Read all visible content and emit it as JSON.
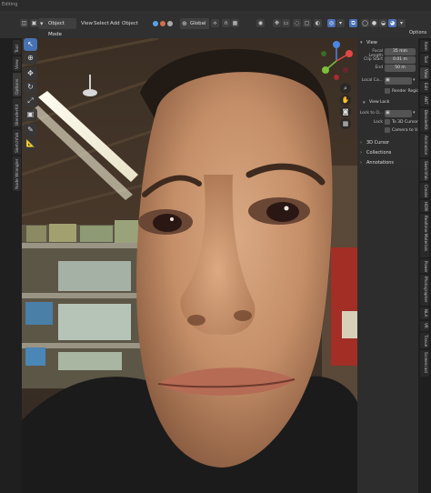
{
  "window": {
    "top_edge_text": "Editing"
  },
  "header": {
    "mode": "Object Mode",
    "menus": [
      "View",
      "Select",
      "Add",
      "Object"
    ],
    "transform_orientation": "Global",
    "options_label": "Options"
  },
  "left_tabs": [
    "Tool",
    "View",
    "Options",
    "BlenderKit",
    "Sketchfab",
    "Node Wrangler"
  ],
  "n_panel": {
    "view_section": "View",
    "focal_length_label": "Focal Length",
    "focal_length_value": "35 mm",
    "clip_start_label": "Clip Start",
    "clip_start_value": "0.01 m",
    "clip_end_label": "End",
    "clip_end_value": "50 m",
    "local_camera_label": "Local Ca...",
    "render_region_label": "Render Region",
    "view_lock_section": "View Lock",
    "lock_to_object_label": "Lock to O...",
    "lock_label": "Lock",
    "to_3d_cursor_label": "To 3D Cursor",
    "camera_to_view_label": "Camera to V...",
    "cursor_section": "3D Cursor",
    "collections_section": "Collections",
    "annotations_section": "Annotations"
  },
  "right_tabs": [
    "Item",
    "Tool",
    "View",
    "Edit",
    "ANT",
    "BlenderKit",
    "Animation",
    "Sketchfab",
    "Create",
    "HDRI",
    "Realtime Materials",
    "Power",
    "Photographer",
    "NLA",
    "VR",
    "Tissue",
    "Screencast"
  ],
  "colors": {
    "accent": "#4772b3",
    "axis_x": "#e04848",
    "axis_y": "#7cbf3a",
    "axis_z": "#4a86e0"
  }
}
